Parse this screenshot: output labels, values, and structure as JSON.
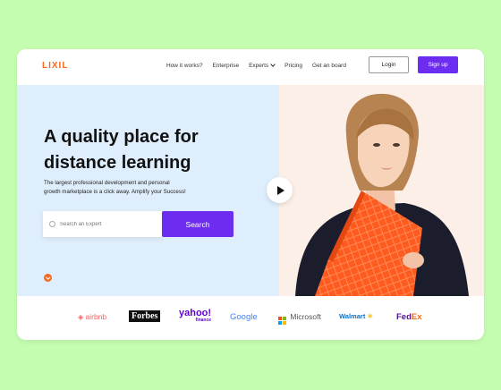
{
  "nav": {
    "logo": "LIXIL",
    "menu": [
      "How it works?",
      "Enterprise",
      "Experts",
      "Pricing",
      "Get an board"
    ],
    "login_label": "Login",
    "signup_label": "Sign up"
  },
  "hero": {
    "headline_line1": "A quality place for",
    "headline_line2": "distance learning",
    "sub_line1": "The largest professional development and personal",
    "sub_line2": "growth marketplace is a click away. Amplify your Success!",
    "search_placeholder": "Search an Expert",
    "search_button": "Search"
  },
  "brands": {
    "airbnb": "airbnb",
    "forbes": "Forbes",
    "yahoo": "yahoo!",
    "yahoo_sub": "finance",
    "google": "Google",
    "microsoft": "Microsoft",
    "walmart": "Walmart",
    "fedex_fed": "Fed",
    "fedex_ex": "Ex"
  },
  "colors": {
    "accent": "#6c2df0",
    "brand": "#f26b21",
    "background": "#c5fdb0"
  }
}
